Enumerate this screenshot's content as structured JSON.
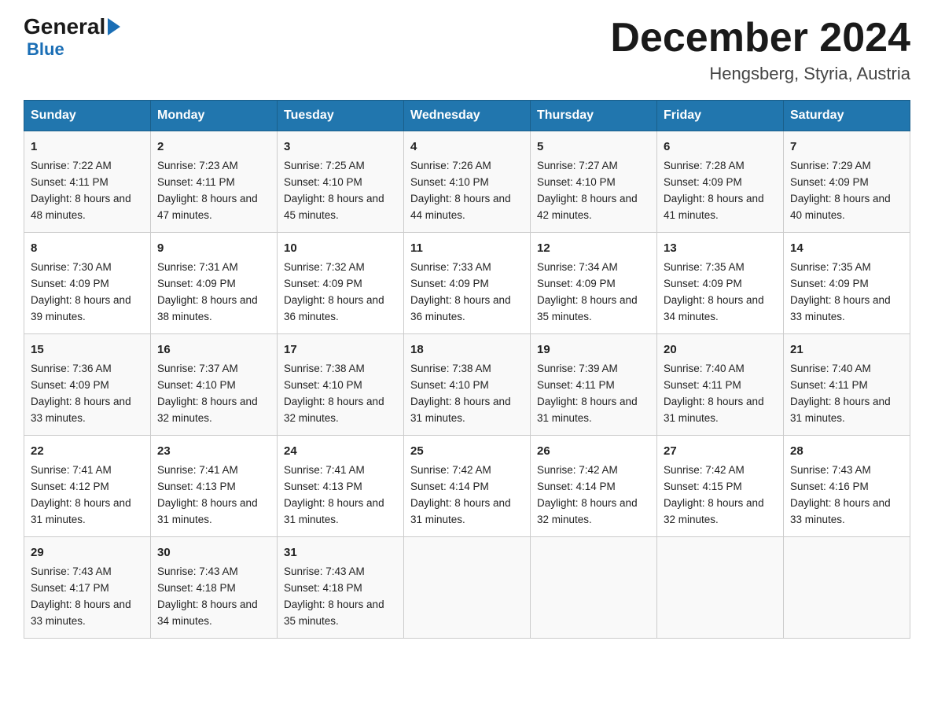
{
  "logo": {
    "general": "General",
    "blue": "Blue",
    "arrow": "▶"
  },
  "title": "December 2024",
  "location": "Hengsberg, Styria, Austria",
  "days_header": [
    "Sunday",
    "Monday",
    "Tuesday",
    "Wednesday",
    "Thursday",
    "Friday",
    "Saturday"
  ],
  "weeks": [
    [
      {
        "day": "1",
        "sunrise": "Sunrise: 7:22 AM",
        "sunset": "Sunset: 4:11 PM",
        "daylight": "Daylight: 8 hours and 48 minutes."
      },
      {
        "day": "2",
        "sunrise": "Sunrise: 7:23 AM",
        "sunset": "Sunset: 4:11 PM",
        "daylight": "Daylight: 8 hours and 47 minutes."
      },
      {
        "day": "3",
        "sunrise": "Sunrise: 7:25 AM",
        "sunset": "Sunset: 4:10 PM",
        "daylight": "Daylight: 8 hours and 45 minutes."
      },
      {
        "day": "4",
        "sunrise": "Sunrise: 7:26 AM",
        "sunset": "Sunset: 4:10 PM",
        "daylight": "Daylight: 8 hours and 44 minutes."
      },
      {
        "day": "5",
        "sunrise": "Sunrise: 7:27 AM",
        "sunset": "Sunset: 4:10 PM",
        "daylight": "Daylight: 8 hours and 42 minutes."
      },
      {
        "day": "6",
        "sunrise": "Sunrise: 7:28 AM",
        "sunset": "Sunset: 4:09 PM",
        "daylight": "Daylight: 8 hours and 41 minutes."
      },
      {
        "day": "7",
        "sunrise": "Sunrise: 7:29 AM",
        "sunset": "Sunset: 4:09 PM",
        "daylight": "Daylight: 8 hours and 40 minutes."
      }
    ],
    [
      {
        "day": "8",
        "sunrise": "Sunrise: 7:30 AM",
        "sunset": "Sunset: 4:09 PM",
        "daylight": "Daylight: 8 hours and 39 minutes."
      },
      {
        "day": "9",
        "sunrise": "Sunrise: 7:31 AM",
        "sunset": "Sunset: 4:09 PM",
        "daylight": "Daylight: 8 hours and 38 minutes."
      },
      {
        "day": "10",
        "sunrise": "Sunrise: 7:32 AM",
        "sunset": "Sunset: 4:09 PM",
        "daylight": "Daylight: 8 hours and 36 minutes."
      },
      {
        "day": "11",
        "sunrise": "Sunrise: 7:33 AM",
        "sunset": "Sunset: 4:09 PM",
        "daylight": "Daylight: 8 hours and 36 minutes."
      },
      {
        "day": "12",
        "sunrise": "Sunrise: 7:34 AM",
        "sunset": "Sunset: 4:09 PM",
        "daylight": "Daylight: 8 hours and 35 minutes."
      },
      {
        "day": "13",
        "sunrise": "Sunrise: 7:35 AM",
        "sunset": "Sunset: 4:09 PM",
        "daylight": "Daylight: 8 hours and 34 minutes."
      },
      {
        "day": "14",
        "sunrise": "Sunrise: 7:35 AM",
        "sunset": "Sunset: 4:09 PM",
        "daylight": "Daylight: 8 hours and 33 minutes."
      }
    ],
    [
      {
        "day": "15",
        "sunrise": "Sunrise: 7:36 AM",
        "sunset": "Sunset: 4:09 PM",
        "daylight": "Daylight: 8 hours and 33 minutes."
      },
      {
        "day": "16",
        "sunrise": "Sunrise: 7:37 AM",
        "sunset": "Sunset: 4:10 PM",
        "daylight": "Daylight: 8 hours and 32 minutes."
      },
      {
        "day": "17",
        "sunrise": "Sunrise: 7:38 AM",
        "sunset": "Sunset: 4:10 PM",
        "daylight": "Daylight: 8 hours and 32 minutes."
      },
      {
        "day": "18",
        "sunrise": "Sunrise: 7:38 AM",
        "sunset": "Sunset: 4:10 PM",
        "daylight": "Daylight: 8 hours and 31 minutes."
      },
      {
        "day": "19",
        "sunrise": "Sunrise: 7:39 AM",
        "sunset": "Sunset: 4:11 PM",
        "daylight": "Daylight: 8 hours and 31 minutes."
      },
      {
        "day": "20",
        "sunrise": "Sunrise: 7:40 AM",
        "sunset": "Sunset: 4:11 PM",
        "daylight": "Daylight: 8 hours and 31 minutes."
      },
      {
        "day": "21",
        "sunrise": "Sunrise: 7:40 AM",
        "sunset": "Sunset: 4:11 PM",
        "daylight": "Daylight: 8 hours and 31 minutes."
      }
    ],
    [
      {
        "day": "22",
        "sunrise": "Sunrise: 7:41 AM",
        "sunset": "Sunset: 4:12 PM",
        "daylight": "Daylight: 8 hours and 31 minutes."
      },
      {
        "day": "23",
        "sunrise": "Sunrise: 7:41 AM",
        "sunset": "Sunset: 4:13 PM",
        "daylight": "Daylight: 8 hours and 31 minutes."
      },
      {
        "day": "24",
        "sunrise": "Sunrise: 7:41 AM",
        "sunset": "Sunset: 4:13 PM",
        "daylight": "Daylight: 8 hours and 31 minutes."
      },
      {
        "day": "25",
        "sunrise": "Sunrise: 7:42 AM",
        "sunset": "Sunset: 4:14 PM",
        "daylight": "Daylight: 8 hours and 31 minutes."
      },
      {
        "day": "26",
        "sunrise": "Sunrise: 7:42 AM",
        "sunset": "Sunset: 4:14 PM",
        "daylight": "Daylight: 8 hours and 32 minutes."
      },
      {
        "day": "27",
        "sunrise": "Sunrise: 7:42 AM",
        "sunset": "Sunset: 4:15 PM",
        "daylight": "Daylight: 8 hours and 32 minutes."
      },
      {
        "day": "28",
        "sunrise": "Sunrise: 7:43 AM",
        "sunset": "Sunset: 4:16 PM",
        "daylight": "Daylight: 8 hours and 33 minutes."
      }
    ],
    [
      {
        "day": "29",
        "sunrise": "Sunrise: 7:43 AM",
        "sunset": "Sunset: 4:17 PM",
        "daylight": "Daylight: 8 hours and 33 minutes."
      },
      {
        "day": "30",
        "sunrise": "Sunrise: 7:43 AM",
        "sunset": "Sunset: 4:18 PM",
        "daylight": "Daylight: 8 hours and 34 minutes."
      },
      {
        "day": "31",
        "sunrise": "Sunrise: 7:43 AM",
        "sunset": "Sunset: 4:18 PM",
        "daylight": "Daylight: 8 hours and 35 minutes."
      },
      null,
      null,
      null,
      null
    ]
  ]
}
